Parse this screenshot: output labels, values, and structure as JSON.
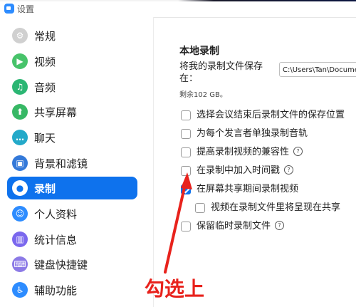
{
  "window": {
    "title": "设置"
  },
  "sidebar": {
    "items": [
      {
        "label": "常规",
        "icon": "gear-icon",
        "color": "#c8c8c8",
        "glyph": "⚙"
      },
      {
        "label": "视频",
        "icon": "video-icon",
        "color": "#47c36a",
        "glyph": "▶"
      },
      {
        "label": "音频",
        "icon": "headphones-icon",
        "color": "#2bb673",
        "glyph": "♫"
      },
      {
        "label": "共享屏幕",
        "icon": "share-screen-icon",
        "color": "#37b865",
        "glyph": "⬆"
      },
      {
        "label": "聊天",
        "icon": "chat-icon",
        "color": "#23a9c9",
        "glyph": "…"
      },
      {
        "label": "背景和滤镜",
        "icon": "background-icon",
        "color": "#3479d9",
        "glyph": "▣"
      },
      {
        "label": "录制",
        "icon": "record-icon",
        "color": "#ffffff",
        "glyph": "●",
        "active": true
      },
      {
        "label": "个人资料",
        "icon": "profile-icon",
        "color": "#2d8cff",
        "glyph": "👤"
      },
      {
        "label": "统计信息",
        "icon": "statistics-icon",
        "color": "#7b68ee",
        "glyph": "▥"
      },
      {
        "label": "键盘快捷键",
        "icon": "keyboard-icon",
        "color": "#8c7ae6",
        "glyph": "⌨"
      },
      {
        "label": "辅助功能",
        "icon": "accessibility-icon",
        "color": "#2d8cff",
        "glyph": "♿"
      }
    ]
  },
  "recording": {
    "section_title": "本地录制",
    "save_location_label": "将我的录制文件保存在：",
    "save_path": "C:\\Users\\Tan\\Documents",
    "remaining_space": "剩余102 GB。",
    "options": [
      {
        "label": "选择会议结束后录制文件的保存位置",
        "checked": false,
        "help": false
      },
      {
        "label": "为每个发言者单独录制音轨",
        "checked": false,
        "help": false
      },
      {
        "label": "提高录制视频的兼容性",
        "checked": false,
        "help": true
      },
      {
        "label": "在录制中加入时间戳",
        "checked": false,
        "help": true
      },
      {
        "label": "在屏幕共享期间录制视频",
        "checked": true,
        "help": false
      },
      {
        "label": "视频在录制文件里将呈现在共享",
        "checked": false,
        "help": false
      },
      {
        "label": "保留临时录制文件",
        "checked": false,
        "help": true
      }
    ]
  },
  "annotation": {
    "text": "勾选上",
    "color": "#e8221c"
  },
  "colors": {
    "accent": "#0e72ed"
  }
}
